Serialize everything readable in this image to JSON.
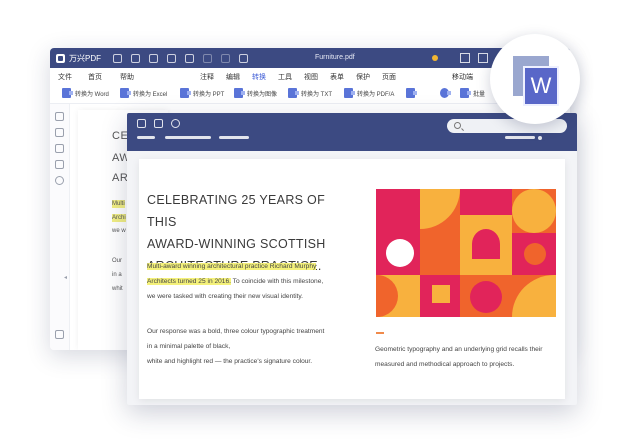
{
  "app": {
    "name": "万兴PDF",
    "file_name": "Furniture.pdf"
  },
  "menu": {
    "items": [
      "文件",
      "首页",
      "帮助",
      "注释",
      "编辑",
      "转换",
      "工具",
      "视图",
      "表单",
      "保护",
      "页面"
    ],
    "active": "转换",
    "right_label": "移动端"
  },
  "toolbar": {
    "items": [
      "转换为 Word",
      "转换为 Excel",
      "转换为 PPT",
      "转换为图像",
      "转换为 TXT",
      "转换为 PDF/A"
    ],
    "more_label": "批量"
  },
  "back_document": {
    "heading_fragments": [
      "CE",
      "AW",
      "AR"
    ],
    "highlight_fragments": [
      "Multi",
      "Archi"
    ],
    "text_fragments": [
      "we w",
      "Our",
      "in a",
      "whit"
    ]
  },
  "document": {
    "heading_lines": [
      "CELEBRATING 25 YEARS OF THIS",
      "AWARD-WINNING SCOTTISH",
      "ARCHITECTURE PRACTICE."
    ],
    "para1": {
      "highlight_line1": "Multi-award winning architectural practice Richard Murphy",
      "highlight_line2": "Architects turned 25 in 2016.",
      "rest_line2": " To coincide with this milestone,",
      "line3": "we were tasked with creating their new visual identity."
    },
    "para2": {
      "line1": "Our response was a bold, three colour typographic treatment",
      "line2": "in a minimal palette of black,",
      "line3": "white and highlight red — the practice's signature colour."
    },
    "caption": {
      "line1": "Geometric typography and an underlying grid recalls their",
      "line2": "measured and methodical approach to projects."
    }
  },
  "badge": {
    "letter": "W",
    "icon": "word-icon"
  },
  "colors": {
    "titlebar": "#3c4a82",
    "accent": "#3d5bd6",
    "highlight": "#f4f17a",
    "art_red": "#e1245a",
    "art_orange": "#f0642c",
    "art_yellow": "#f8b13e"
  }
}
